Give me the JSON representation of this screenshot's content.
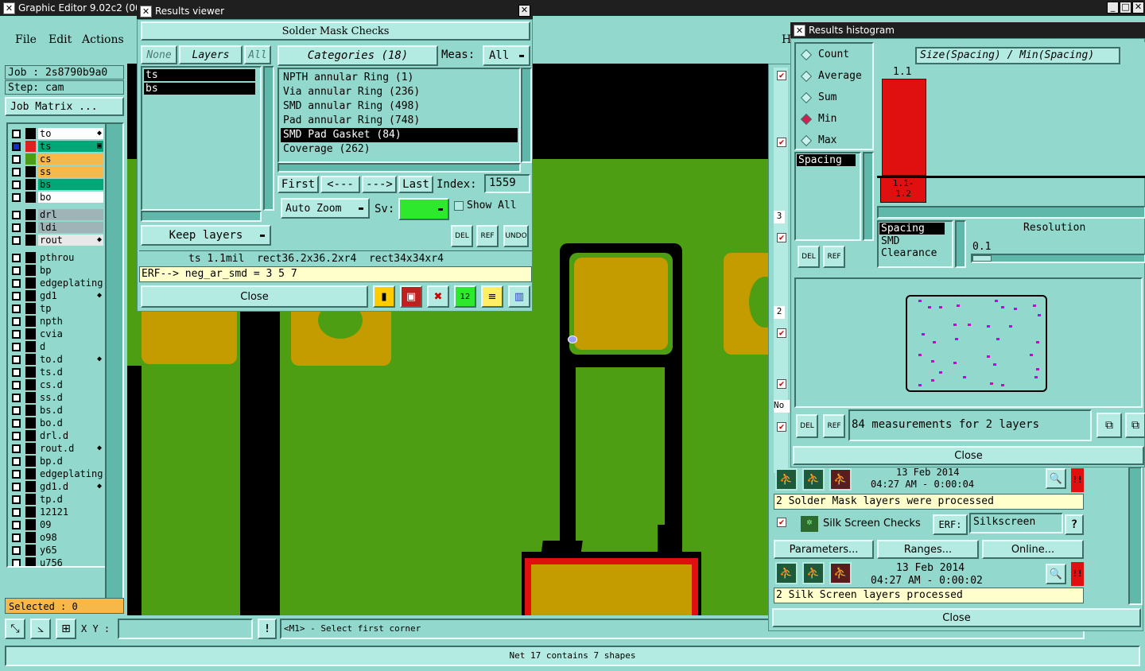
{
  "main_window": {
    "title": "Graphic Editor 9.02c2 (00",
    "menu": [
      "File",
      "Edit",
      "Actions"
    ],
    "hint_letter": "H",
    "job_label": "Job : 2s8790b9a0",
    "step_label": "Step: cam",
    "job_matrix_label": "Job Matrix ...",
    "selected_label": "Selected : 0",
    "xy_label": "X Y :",
    "xy_value": "",
    "info_btn": "!",
    "prompt": "<M1> - Select first corner",
    "status_bar": "Net 17 contains 7 shapes"
  },
  "layers": [
    {
      "name": "to",
      "color": "#ffffff",
      "swatch": "#000000",
      "mark": "◆",
      "active": false
    },
    {
      "name": "ts",
      "color": "#00a878",
      "swatch": "#e02020",
      "mark": "▣",
      "active": true
    },
    {
      "name": "cs",
      "color": "#f7b84a",
      "swatch": "#4e9e13",
      "mark": "",
      "active": false
    },
    {
      "name": "ss",
      "color": "#f7b84a",
      "swatch": "#000000",
      "mark": "",
      "active": false
    },
    {
      "name": "bs",
      "color": "#00a878",
      "swatch": "#000000",
      "mark": "",
      "active": false
    },
    {
      "name": "bo",
      "color": "#ffffff",
      "swatch": "#000000",
      "mark": "",
      "active": false
    },
    {
      "name": "drl",
      "color": "#a0b4b8",
      "swatch": "#000000",
      "mark": "",
      "active": false
    },
    {
      "name": "ldi",
      "color": "#a0b4b8",
      "swatch": "#000000",
      "mark": "",
      "active": false
    },
    {
      "name": "rout",
      "color": "#e8e8e8",
      "swatch": "#000000",
      "mark": "◆",
      "active": false
    },
    {
      "name": "pthrou",
      "color": "#92d8cc",
      "swatch": "#000000",
      "mark": "",
      "active": false
    },
    {
      "name": "bp",
      "color": "#92d8cc",
      "swatch": "#000000",
      "mark": "",
      "active": false
    },
    {
      "name": "edgeplating",
      "color": "#92d8cc",
      "swatch": "#000000",
      "mark": "",
      "active": false
    },
    {
      "name": "gd1",
      "color": "#92d8cc",
      "swatch": "#000000",
      "mark": "◆",
      "active": false
    },
    {
      "name": "tp",
      "color": "#92d8cc",
      "swatch": "#000000",
      "mark": "",
      "active": false
    },
    {
      "name": "npth",
      "color": "#92d8cc",
      "swatch": "#000000",
      "mark": "",
      "active": false
    },
    {
      "name": "cvia",
      "color": "#92d8cc",
      "swatch": "#000000",
      "mark": "",
      "active": false
    },
    {
      "name": "d",
      "color": "#92d8cc",
      "swatch": "#000000",
      "mark": "",
      "active": false
    },
    {
      "name": "to.d",
      "color": "#92d8cc",
      "swatch": "#000000",
      "mark": "◆",
      "active": false
    },
    {
      "name": "ts.d",
      "color": "#92d8cc",
      "swatch": "#000000",
      "mark": "",
      "active": false
    },
    {
      "name": "cs.d",
      "color": "#92d8cc",
      "swatch": "#000000",
      "mark": "",
      "active": false
    },
    {
      "name": "ss.d",
      "color": "#92d8cc",
      "swatch": "#000000",
      "mark": "",
      "active": false
    },
    {
      "name": "bs.d",
      "color": "#92d8cc",
      "swatch": "#000000",
      "mark": "",
      "active": false
    },
    {
      "name": "bo.d",
      "color": "#92d8cc",
      "swatch": "#000000",
      "mark": "",
      "active": false
    },
    {
      "name": "drl.d",
      "color": "#92d8cc",
      "swatch": "#000000",
      "mark": "",
      "active": false
    },
    {
      "name": "rout.d",
      "color": "#92d8cc",
      "swatch": "#000000",
      "mark": "◆",
      "active": false
    },
    {
      "name": "bp.d",
      "color": "#92d8cc",
      "swatch": "#000000",
      "mark": "",
      "active": false
    },
    {
      "name": "edgeplating",
      "color": "#92d8cc",
      "swatch": "#000000",
      "mark": "",
      "active": false
    },
    {
      "name": "gd1.d",
      "color": "#92d8cc",
      "swatch": "#000000",
      "mark": "◆",
      "active": false
    },
    {
      "name": "tp.d",
      "color": "#92d8cc",
      "swatch": "#000000",
      "mark": "",
      "active": false
    },
    {
      "name": "12121",
      "color": "#92d8cc",
      "swatch": "#000000",
      "mark": "",
      "active": false
    },
    {
      "name": "09",
      "color": "#92d8cc",
      "swatch": "#000000",
      "mark": "",
      "active": false
    },
    {
      "name": "o98",
      "color": "#92d8cc",
      "swatch": "#000000",
      "mark": "",
      "active": false
    },
    {
      "name": "y65",
      "color": "#92d8cc",
      "swatch": "#000000",
      "mark": "",
      "active": false
    },
    {
      "name": "u756",
      "color": "#92d8cc",
      "swatch": "#000000",
      "mark": "",
      "active": false
    }
  ],
  "results_viewer": {
    "title": "Results viewer",
    "header": "Solder Mask Checks",
    "none_btn": "None",
    "layers_btn": "Layers",
    "all_btn": "All",
    "categories_btn": "Categories (18)",
    "meas_label": "Meas:",
    "meas_value": "All",
    "layer_list": [
      "ts",
      "bs"
    ],
    "categories": [
      "NPTH annular Ring (1)",
      "Via annular Ring (236)",
      "SMD annular Ring (498)",
      "Pad annular Ring (748)",
      "SMD Pad Gasket (84)",
      "Coverage (262)"
    ],
    "selected_category_index": 4,
    "first_btn": "First",
    "prev_btn": "<---",
    "next_btn": "--->",
    "last_btn": "Last",
    "index_label": "Index:",
    "index_value": "1559",
    "auto_zoom": "Auto Zoom",
    "sv_label": "Sv:",
    "show_all": "Show All",
    "keep_layers": "Keep layers",
    "del_icon": "DEL",
    "ref_icon": "REF",
    "undo_icon": "UNDO",
    "measurement_line": "ts 1.1mil  rect36.2x36.2xr4  rect34x34xr4",
    "erf_line": "ERF--> neg_ar_smd = 3 5 7",
    "close": "Close"
  },
  "histogram": {
    "title": "Results histogram",
    "modes": [
      "Count",
      "Average",
      "Sum",
      "Min",
      "Max"
    ],
    "selected_mode_index": 3,
    "metric_list": [
      "Spacing"
    ],
    "plot_title": "Size(Spacing) / Min(Spacing)",
    "bar_label": "1.1",
    "bin_label_1": "1.1-",
    "bin_label_2": "1.2",
    "measure_types": [
      "Spacing",
      "SMD",
      "Clearance"
    ],
    "resolution_label": "Resolution",
    "resolution_value": "0.1",
    "del_icon": "DEL",
    "ref_icon": "REF",
    "summary": "84 measurements for 2 layers",
    "close": "Close"
  },
  "checklist": {
    "side_numbers": [
      "3",
      "2"
    ],
    "side_label": "No",
    "date1": "13 Feb 2014",
    "time1": "04:27 AM - 0:00:04",
    "processed1": "2 Solder Mask layers were processed",
    "silk_title": "Silk Screen Checks",
    "erf_label": "ERF:",
    "erf_value": "Silkscreen",
    "help": "?",
    "parameters": "Parameters...",
    "ranges": "Ranges...",
    "online": "Online...",
    "date2": "13 Feb 2014",
    "time2": "04:27 AM - 0:00:02",
    "processed2": "2 Silk Screen layers processed",
    "close": "Close",
    "alert": "!!"
  }
}
